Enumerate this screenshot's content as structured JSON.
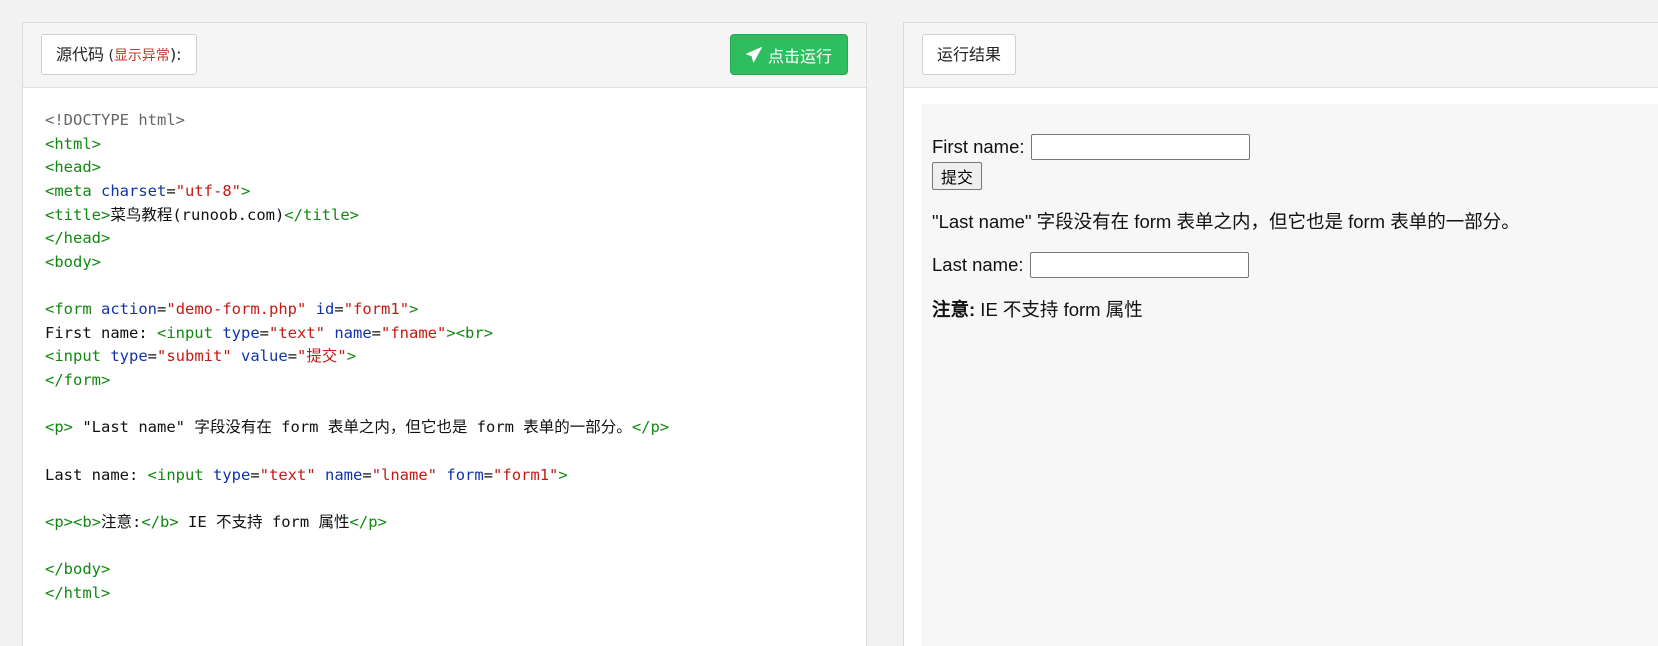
{
  "editor": {
    "label_main": "源代码",
    "label_open": " (",
    "label_warn": "显示异常",
    "label_close": "):",
    "run_button": "点击运行",
    "code_lines": [
      "<!DOCTYPE html>",
      "<html>",
      "<head>",
      "<meta charset=\"utf-8\">",
      "<title>菜鸟教程(runoob.com)</title>",
      "</head>",
      "<body>",
      "",
      "<form action=\"demo-form.php\" id=\"form1\">",
      "First name: <input type=\"text\" name=\"fname\"><br>",
      "<input type=\"submit\" value=\"提交\">",
      "</form>",
      "",
      "<p> \"Last name\" 字段没有在 form 表单之内，但它也是 form 表单的一部分。</p>",
      "",
      "Last name: <input type=\"text\" name=\"lname\" form=\"form1\">",
      "",
      "<p><b>注意:</b> IE 不支持 form 属性</p>",
      "",
      "</body>",
      "</html>"
    ]
  },
  "result": {
    "label": "运行结果",
    "first_name_label": "First name:",
    "first_name_value": "",
    "submit_label": "提交",
    "paragraph": "\"Last name\" 字段没有在 form 表单之内，但它也是 form 表单的一部分。",
    "last_name_label": "Last name:",
    "last_name_value": "",
    "note_bold": "注意:",
    "note_text": " IE 不支持 form 属性"
  }
}
